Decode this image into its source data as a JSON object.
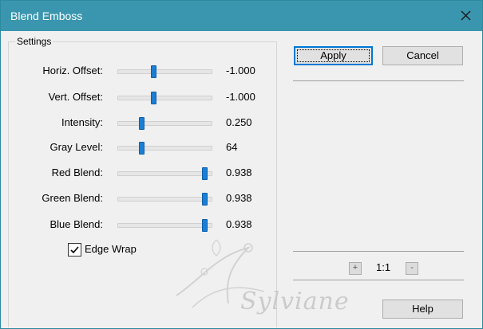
{
  "window": {
    "title": "Blend Emboss"
  },
  "settings": {
    "group_label": "Settings",
    "sliders": [
      {
        "label": "Horiz. Offset:",
        "value": "-1.000",
        "fraction": 0.38
      },
      {
        "label": "Vert. Offset:",
        "value": "-1.000",
        "fraction": 0.38
      },
      {
        "label": "Intensity:",
        "value": "0.250",
        "fraction": 0.25
      },
      {
        "label": "Gray Level:",
        "value": "64",
        "fraction": 0.25
      },
      {
        "label": "Red Blend:",
        "value": "0.938",
        "fraction": 0.92
      },
      {
        "label": "Green Blend:",
        "value": "0.938",
        "fraction": 0.92
      },
      {
        "label": "Blue Blend:",
        "value": "0.938",
        "fraction": 0.92
      }
    ],
    "edge_wrap": {
      "label": "Edge Wrap",
      "checked": true
    }
  },
  "buttons": {
    "apply": "Apply",
    "cancel": "Cancel",
    "help": "Help"
  },
  "zoom": {
    "plus": "+",
    "level": "1:1",
    "minus": "-"
  },
  "watermark": {
    "text": "Sylviane"
  },
  "colors": {
    "titlebar": "#3a96ae",
    "slider_thumb": "#1a7fd4"
  }
}
